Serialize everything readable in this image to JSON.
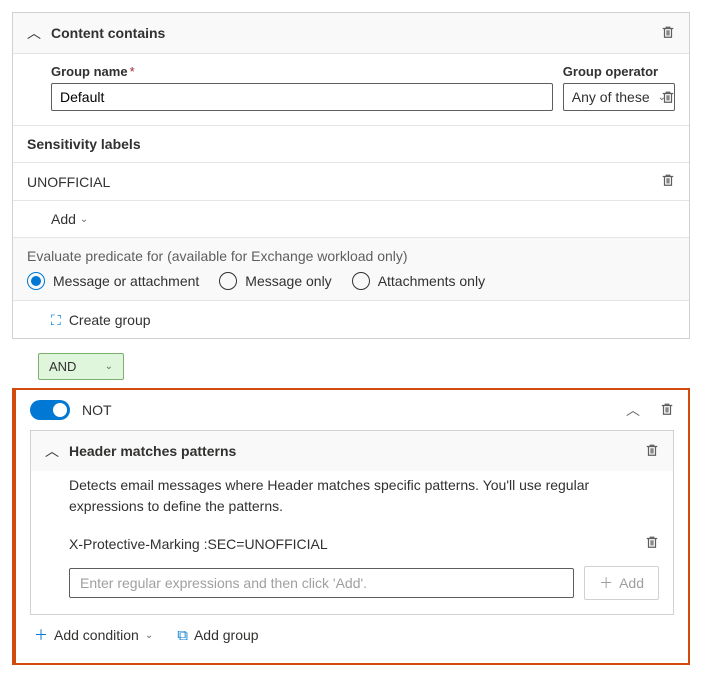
{
  "content_contains": {
    "title": "Content contains",
    "group_name_label": "Group name",
    "group_name_value": "Default",
    "group_operator_label": "Group operator",
    "group_operator_value": "Any of these",
    "sensitivity_labels_header": "Sensitivity labels",
    "sensitivity_items": [
      {
        "label": "UNOFFICIAL"
      }
    ],
    "add_label": "Add",
    "predicate_hint": "Evaluate predicate for (available for Exchange workload only)",
    "predicate_options": [
      {
        "label": "Message or attachment",
        "selected": true
      },
      {
        "label": "Message only",
        "selected": false
      },
      {
        "label": "Attachments only",
        "selected": false
      }
    ],
    "create_group_label": "Create group"
  },
  "boolean_pill": "AND",
  "not": {
    "label": "NOT",
    "header_matches": {
      "title": "Header matches patterns",
      "description": "Detects email messages where Header matches specific patterns. You'll use regular expressions to define the patterns.",
      "patterns": [
        {
          "value": "X-Protective-Marking :SEC=UNOFFICIAL"
        }
      ],
      "input_placeholder": "Enter regular expressions and then click 'Add'.",
      "add_button": "Add"
    },
    "add_condition_label": "Add condition",
    "add_group_label": "Add group"
  }
}
